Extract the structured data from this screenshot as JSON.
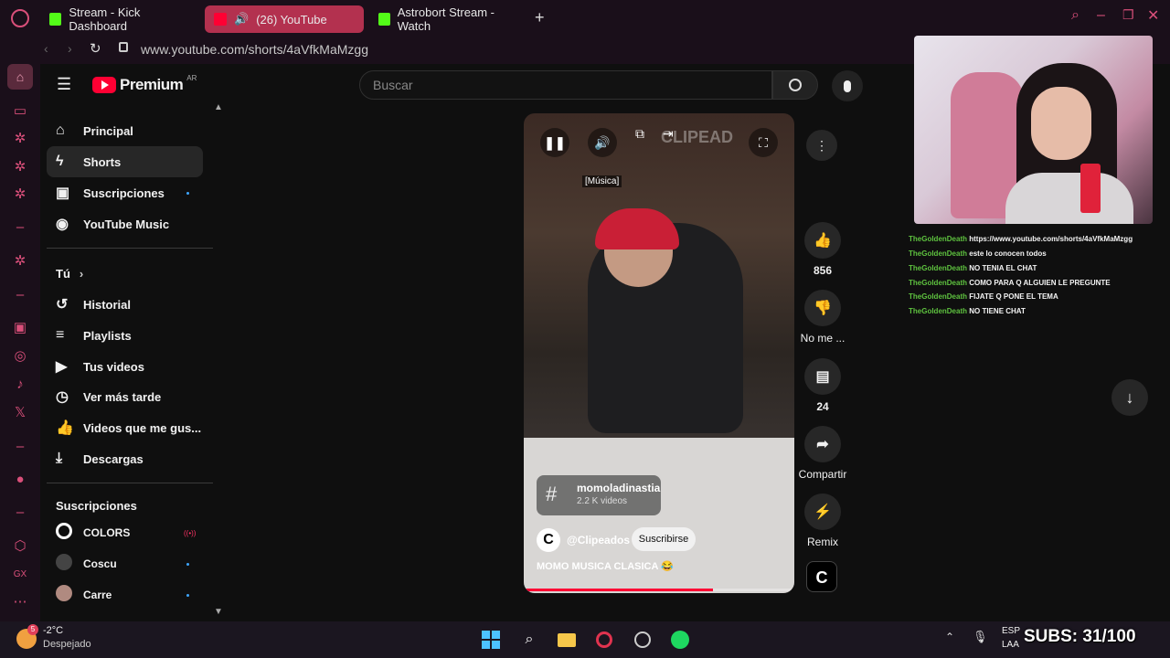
{
  "browser": {
    "tabs": [
      {
        "label": "Stream - Kick Dashboard",
        "active": false
      },
      {
        "label": "(26) YouTube",
        "active": true
      },
      {
        "label": "Astrobort Stream - Watch",
        "active": false
      }
    ],
    "url": "www.youtube.com/shorts/4aVfkMaMzgg"
  },
  "youtube": {
    "logo_text": "Premium",
    "logo_region": "AR",
    "search_placeholder": "Buscar",
    "nav_main": [
      {
        "label": "Principal",
        "icon": "home-icon"
      },
      {
        "label": "Shorts",
        "icon": "shorts-icon"
      },
      {
        "label": "Suscripciones",
        "icon": "subscriptions-icon"
      },
      {
        "label": "YouTube Music",
        "icon": "music-icon"
      }
    ],
    "you_heading": "Tú",
    "nav_you": [
      {
        "label": "Historial",
        "icon": "history-icon"
      },
      {
        "label": "Playlists",
        "icon": "playlists-icon"
      },
      {
        "label": "Tus videos",
        "icon": "your-videos-icon"
      },
      {
        "label": "Ver más tarde",
        "icon": "watch-later-icon"
      },
      {
        "label": "Videos que me gus...",
        "icon": "liked-icon"
      },
      {
        "label": "Descargas",
        "icon": "download-icon"
      }
    ],
    "subs_heading": "Suscripciones",
    "subscriptions": [
      {
        "label": "COLORS"
      },
      {
        "label": "Coscu"
      },
      {
        "label": "Carre"
      }
    ]
  },
  "short": {
    "overlay_caption": "[Música]",
    "watermark": "CLIPEAD",
    "hashtag": "momoladinastia",
    "hashtag_count": "2.2 K videos",
    "channel": "@Clipeados",
    "subscribe_label": "Suscribirse",
    "title": "MOMO MUSICA CLASICA 😂",
    "progress": 0.7,
    "actions": {
      "like_count": "856",
      "dislike_label": "No me ...",
      "comments_count": "24",
      "share_label": "Compartir",
      "remix_label": "Remix"
    }
  },
  "chat": [
    {
      "user": "TheGoldenDeath",
      "msg": "https://www.youtube.com/shorts/4aVfkMaMzgg"
    },
    {
      "user": "TheGoldenDeath",
      "msg": "este lo conocen todos"
    },
    {
      "user": "TheGoldenDeath",
      "msg": "NO TENIA EL CHAT"
    },
    {
      "user": "TheGoldenDeath",
      "msg": "COMO PARA Q ALGUIEN LE PREGUNTE"
    },
    {
      "user": "TheGoldenDeath",
      "msg": "FIJATE Q PONE EL TEMA"
    },
    {
      "user": "TheGoldenDeath",
      "msg": "NO TIENE CHAT"
    }
  ],
  "taskbar": {
    "weather_temp": "-2°C",
    "weather_desc": "Despejado",
    "weather_badge": "5",
    "lang_top": "ESP",
    "lang_bottom": "LAA",
    "subs_overlay": "SUBS: 31/100"
  },
  "colors": {
    "accent": "#ff0033",
    "chat_user": "#5ec23f",
    "kick_green": "#53fc18",
    "opera_red": "#d94f7a"
  }
}
